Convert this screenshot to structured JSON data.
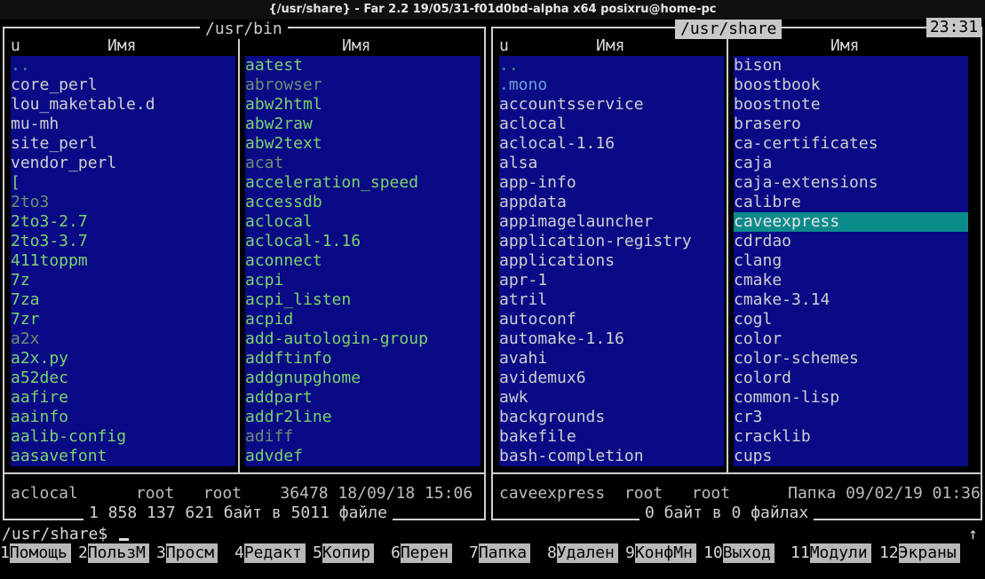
{
  "window": {
    "title": "{/usr/share} - Far 2.2 19/05/31-f01d0bd-alpha x64 posixru@home-pc"
  },
  "clock": "23:31",
  "left_panel": {
    "path": "/usr/bin",
    "col_headers": {
      "mark": "u",
      "name1": "Имя",
      "name2": "Имя"
    },
    "col1": [
      {
        "name": "..",
        "style": "dim"
      },
      {
        "name": "core_perl",
        "style": "normal"
      },
      {
        "name": "lou_maketable.d",
        "style": "normal"
      },
      {
        "name": "mu-mh",
        "style": "normal"
      },
      {
        "name": "site_perl",
        "style": "normal"
      },
      {
        "name": "vendor_perl",
        "style": "normal"
      },
      {
        "name": "[",
        "style": "exe"
      },
      {
        "name": "2to3",
        "style": "hidden"
      },
      {
        "name": "2to3-2.7",
        "style": "exe"
      },
      {
        "name": "2to3-3.7",
        "style": "exe"
      },
      {
        "name": "411toppm",
        "style": "exe"
      },
      {
        "name": "7z",
        "style": "exe"
      },
      {
        "name": "7za",
        "style": "exe"
      },
      {
        "name": "7zr",
        "style": "exe"
      },
      {
        "name": "a2x",
        "style": "hidden"
      },
      {
        "name": "a2x.py",
        "style": "exe"
      },
      {
        "name": "a52dec",
        "style": "exe"
      },
      {
        "name": "aafire",
        "style": "exe"
      },
      {
        "name": "aainfo",
        "style": "exe"
      },
      {
        "name": "aalib-config",
        "style": "exe"
      },
      {
        "name": "aasavefont",
        "style": "exe"
      }
    ],
    "col2": [
      {
        "name": "aatest",
        "style": "exe"
      },
      {
        "name": "abrowser",
        "style": "hidden"
      },
      {
        "name": "abw2html",
        "style": "exe"
      },
      {
        "name": "abw2raw",
        "style": "exe"
      },
      {
        "name": "abw2text",
        "style": "exe"
      },
      {
        "name": "acat",
        "style": "hidden"
      },
      {
        "name": "acceleration_speed",
        "style": "exe"
      },
      {
        "name": "accessdb",
        "style": "exe"
      },
      {
        "name": "aclocal",
        "style": "exe"
      },
      {
        "name": "aclocal-1.16",
        "style": "exe"
      },
      {
        "name": "aconnect",
        "style": "exe"
      },
      {
        "name": "acpi",
        "style": "exe"
      },
      {
        "name": "acpi_listen",
        "style": "exe"
      },
      {
        "name": "acpid",
        "style": "exe"
      },
      {
        "name": "add-autologin-group",
        "style": "exe"
      },
      {
        "name": "addftinfo",
        "style": "exe"
      },
      {
        "name": "addgnupghome",
        "style": "exe"
      },
      {
        "name": "addpart",
        "style": "exe"
      },
      {
        "name": "addr2line",
        "style": "exe"
      },
      {
        "name": "adiff",
        "style": "hidden"
      },
      {
        "name": "advdef",
        "style": "exe"
      }
    ],
    "info": "aclocal      root   root    36478 18/09/18 15:06",
    "summary": "1 858 137 621 байт в 5011 файле"
  },
  "right_panel": {
    "path": "/usr/share",
    "col_headers": {
      "mark": "u",
      "name1": "Имя",
      "name2": "Имя"
    },
    "col1": [
      {
        "name": "..",
        "style": "dim"
      },
      {
        "name": ".mono",
        "style": "linkish"
      },
      {
        "name": "accountsservice",
        "style": "normal"
      },
      {
        "name": "aclocal",
        "style": "normal"
      },
      {
        "name": "aclocal-1.16",
        "style": "normal"
      },
      {
        "name": "alsa",
        "style": "normal"
      },
      {
        "name": "app-info",
        "style": "normal"
      },
      {
        "name": "appdata",
        "style": "normal"
      },
      {
        "name": "appimagelauncher",
        "style": "normal"
      },
      {
        "name": "application-registry",
        "style": "normal"
      },
      {
        "name": "applications",
        "style": "normal"
      },
      {
        "name": "apr-1",
        "style": "normal"
      },
      {
        "name": "atril",
        "style": "normal"
      },
      {
        "name": "autoconf",
        "style": "normal"
      },
      {
        "name": "automake-1.16",
        "style": "normal"
      },
      {
        "name": "avahi",
        "style": "normal"
      },
      {
        "name": "avidemux6",
        "style": "normal"
      },
      {
        "name": "awk",
        "style": "normal"
      },
      {
        "name": "backgrounds",
        "style": "normal"
      },
      {
        "name": "bakefile",
        "style": "normal"
      },
      {
        "name": "bash-completion",
        "style": "normal"
      }
    ],
    "col2": [
      {
        "name": "bison",
        "style": "normal"
      },
      {
        "name": "boostbook",
        "style": "normal"
      },
      {
        "name": "boostnote",
        "style": "normal"
      },
      {
        "name": "brasero",
        "style": "normal"
      },
      {
        "name": "ca-certificates",
        "style": "normal"
      },
      {
        "name": "caja",
        "style": "normal"
      },
      {
        "name": "caja-extensions",
        "style": "normal"
      },
      {
        "name": "calibre",
        "style": "normal"
      },
      {
        "name": "caveexpress",
        "style": "cursor"
      },
      {
        "name": "cdrdao",
        "style": "normal"
      },
      {
        "name": "clang",
        "style": "normal"
      },
      {
        "name": "cmake",
        "style": "normal"
      },
      {
        "name": "cmake-3.14",
        "style": "normal"
      },
      {
        "name": "cogl",
        "style": "normal"
      },
      {
        "name": "color",
        "style": "normal"
      },
      {
        "name": "color-schemes",
        "style": "normal"
      },
      {
        "name": "colord",
        "style": "normal"
      },
      {
        "name": "common-lisp",
        "style": "normal"
      },
      {
        "name": "cr3",
        "style": "normal"
      },
      {
        "name": "cracklib",
        "style": "normal"
      },
      {
        "name": "cups",
        "style": "normal"
      }
    ],
    "info": "caveexpress  root   root      Папка 09/02/19 01:36",
    "summary": "0 байт в 0 файлах"
  },
  "cmdline": {
    "prompt": "/usr/share$",
    "scroll_indicator": "↑"
  },
  "keybar": [
    {
      "num": "1",
      "label": "Помощь"
    },
    {
      "num": "2",
      "label": "ПользМ"
    },
    {
      "num": "3",
      "label": "Просм"
    },
    {
      "num": "4",
      "label": "Редакт"
    },
    {
      "num": "5",
      "label": "Копир"
    },
    {
      "num": "6",
      "label": "Перен"
    },
    {
      "num": "7",
      "label": "Папка"
    },
    {
      "num": "8",
      "label": "Удален"
    },
    {
      "num": "9",
      "label": "КонфМн"
    },
    {
      "num": "10",
      "label": "Выход"
    },
    {
      "num": "11",
      "label": "Модули"
    },
    {
      "num": "12",
      "label": "Экраны"
    }
  ],
  "colors": {
    "panel_bg": "#0a0a86",
    "cursor_bg": "#0b8a8a",
    "exe_fg": "#7bd46b",
    "frame": "#d0d0d0"
  }
}
